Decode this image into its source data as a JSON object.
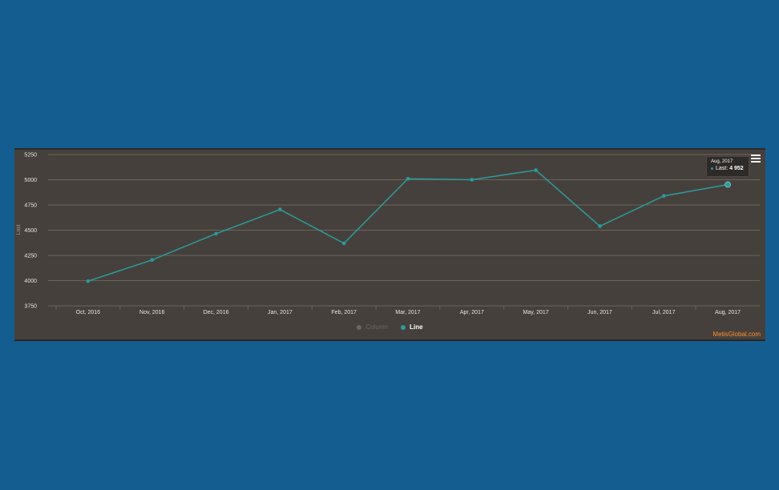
{
  "colors": {
    "page_background": "#145d91",
    "chart_background": "#46403c",
    "series_line": "#2b9c9c",
    "credits": "#ff8f2e"
  },
  "menu": {
    "icon": "hamburger-menu-icon"
  },
  "tooltip": {
    "date": "Aug, 2017",
    "label": "Last:",
    "value": "4 952"
  },
  "legend": {
    "column_label": "Column",
    "line_label": "Line"
  },
  "credits": "MetisGlobal.com",
  "chart_data": {
    "type": "line",
    "ylabel": "Last",
    "xlabel": "",
    "ylim": [
      3750,
      5250
    ],
    "yticks": [
      "3750",
      "4000",
      "4250",
      "4500",
      "4750",
      "5000",
      "5250"
    ],
    "grid": true,
    "legend_placement": "bottom-center",
    "categories": [
      "Oct, 2016",
      "Nov, 2016",
      "Dec, 2016",
      "Jan, 2017",
      "Feb, 2017",
      "Mar, 2017",
      "Apr, 2017",
      "May, 2017",
      "Jun, 2017",
      "Jul, 2017",
      "Aug, 2017"
    ],
    "series": [
      {
        "name": "Column",
        "hidden": true,
        "values": []
      },
      {
        "name": "Line",
        "values": [
          3995,
          4205,
          4465,
          4705,
          4370,
          5010,
          5000,
          5095,
          4540,
          4840,
          4952
        ]
      }
    ],
    "highlighted_point": {
      "category": "Aug, 2017",
      "value": 4952
    }
  }
}
